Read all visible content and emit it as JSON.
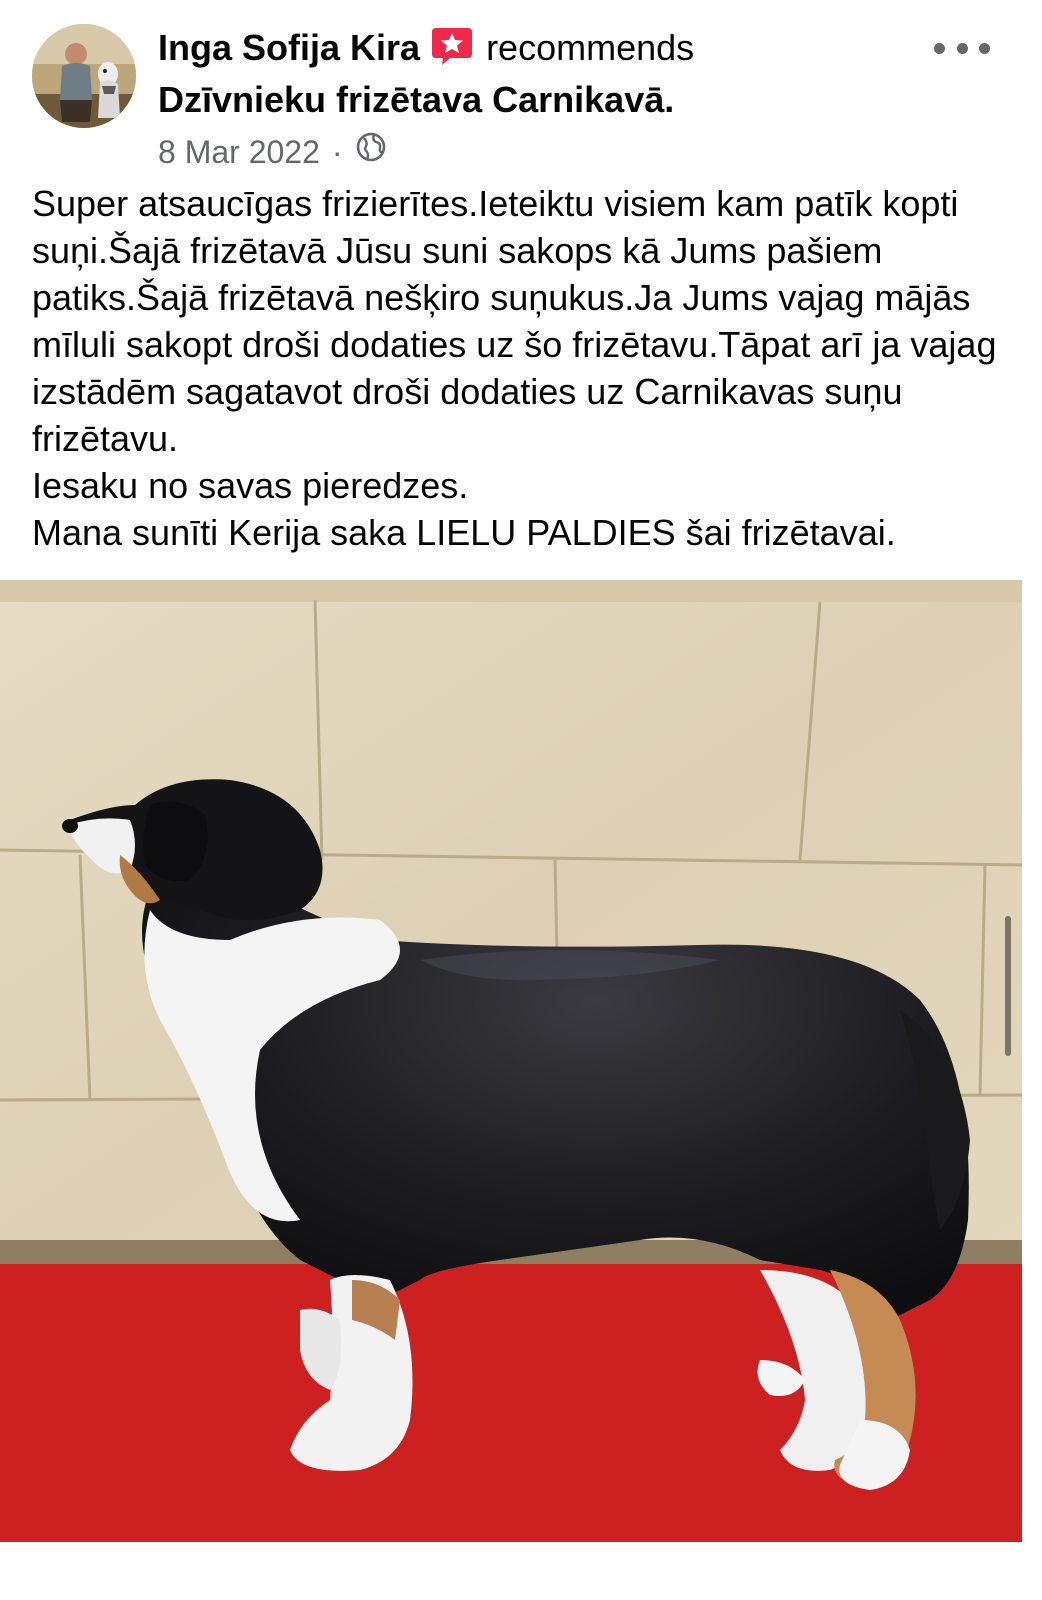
{
  "post": {
    "author": "Inga Sofija Kira",
    "recommend_word": "recommends",
    "page_name": "Dzīvnieku frizētava Carnikavā.",
    "date": "8 Mar 2022",
    "separator": "·",
    "privacy_icon": "globe-icon",
    "badge_icon": "recommendation-star-icon",
    "more_icon": "more-options-icon",
    "body_lines": [
      "Super atsaucīgas frizierītes.Ieteiktu visiem kam patīk kopti suņi.Šajā frizētavā Jūsu suni sakops kā Jums pašiem patiks.Šajā frizētavā nešķiro suņukus.Ja Jums vajag mājās mīluli sakopt droši dodaties uz šo frizētavu.Tāpat arī ja vajag izstādēm sagatavot droši dodaties uz Carnikavas suņu frizētavu.",
      "Iesaku no savas pieredzes.",
      "Mana sunīti Kerija saka LIELU PALDIES šai frizētavai."
    ]
  },
  "colors": {
    "text": "#050505",
    "secondary_text": "#65676b",
    "badge": "#f0284a",
    "carpet_red": "#d42323",
    "wall": "#e2d6bd"
  }
}
